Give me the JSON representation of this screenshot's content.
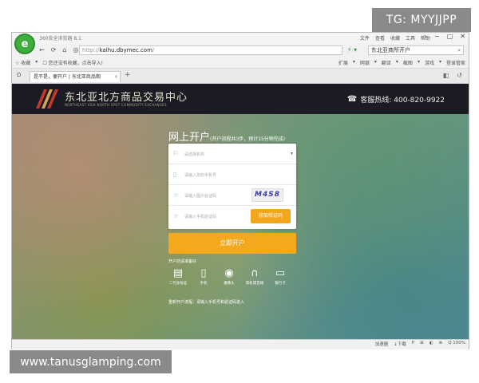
{
  "corner_tag": "TG: MYYJJPP",
  "watermark": "www.tanusglamping.com",
  "browser": {
    "name": "360安全浏览器 8.1",
    "logo_letter": "e",
    "menu": [
      "文件",
      "查看",
      "收藏",
      "工具",
      "帮助"
    ],
    "window_controls": [
      "›",
      "−",
      "▢",
      "✕"
    ],
    "nav_icons": [
      "←",
      "⟳",
      "⌂",
      "◎"
    ],
    "url_prefix": "http://",
    "url_domain": "kaihu.dbymec.com",
    "url_suffix": "/",
    "addr_tools": "⚡ ▾",
    "search_text": "东北亚商所开户",
    "favorites_left": [
      "☆ 收藏",
      "▾",
      "☐ 您还没有收藏，点击导入!"
    ],
    "favorites_right": [
      "扩展",
      "▾",
      "网银",
      "▾",
      "翻译",
      "▾",
      "截图",
      "▾",
      "游戏",
      "▾",
      "登录管家"
    ],
    "tab_side": "D",
    "tab_title": "是不是，便开户 | 东北亚商品期",
    "tab_close": "×",
    "tab_new": "+",
    "tab_right": [
      "◧",
      "↺"
    ],
    "status_items": [
      "加速器",
      "↓下载",
      "P",
      "⊞",
      "◐",
      "⊕",
      "Q 100%"
    ]
  },
  "site": {
    "title": "东北亚北方商品交易中心",
    "subtitle": "NORTHEAST ASIA NORTH SPOT COMMODITY EXCHANGES",
    "phone_icon": "☎",
    "hotline": "客服热线: 400-820-9922",
    "form_title": "网上开户",
    "form_hint": "(开户流程共3步，预计15分钟完成)",
    "fields": [
      {
        "icon": "⚐",
        "placeholder": "请选择机构",
        "type": "select",
        "arrow": "▾"
      },
      {
        "icon": "▯",
        "placeholder": "请输入您的手机号",
        "type": "text"
      },
      {
        "icon": "☆",
        "placeholder": "请输入图片验证码",
        "type": "captcha",
        "captcha": "M4S8"
      },
      {
        "icon": "☆",
        "placeholder": "请输入手机验证码",
        "type": "sms",
        "button": "获取验证码"
      }
    ],
    "submit": "立即开户",
    "docs_title": "开户前请准备好",
    "docs": [
      {
        "icon": "▤",
        "label": "二代身份证"
      },
      {
        "icon": "▯",
        "label": "手机"
      },
      {
        "icon": "◉",
        "label": "摄像头"
      },
      {
        "icon": "∩",
        "label": "耳机或音箱"
      },
      {
        "icon": "▭",
        "label": "银行卡"
      }
    ],
    "note": "重新开户流程：请输入手机号和验证码进入"
  },
  "colors": {
    "header_bg": "#1b1c23",
    "accent_orange": "#f4a81e",
    "logo_green": "#3fae3f"
  }
}
